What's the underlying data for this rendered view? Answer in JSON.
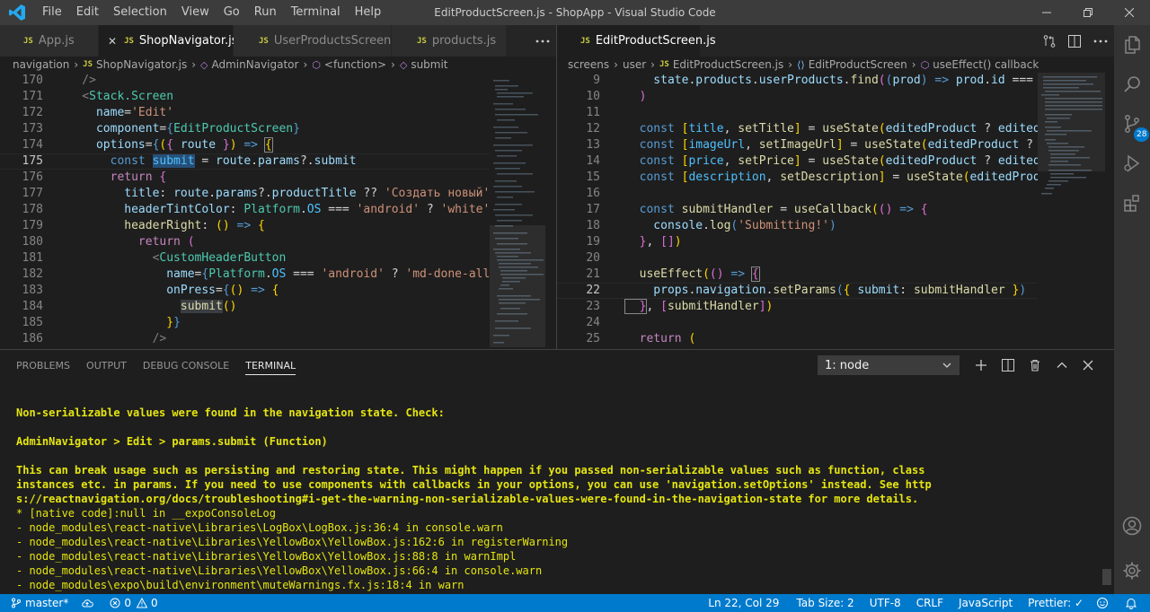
{
  "titlebar": {
    "menu": [
      "File",
      "Edit",
      "Selection",
      "View",
      "Go",
      "Run",
      "Terminal",
      "Help"
    ],
    "title": "EditProductScreen.js - ShopApp - Visual Studio Code"
  },
  "left_group": {
    "tabs": [
      {
        "label": "App.js",
        "active": false
      },
      {
        "label": "ShopNavigator.js",
        "active": true
      },
      {
        "label": "UserProductsScreen.js",
        "active": false
      },
      {
        "label": "products.js",
        "active": false
      }
    ],
    "tab_icon": "JS",
    "breadcrumb": [
      "navigation",
      "ShopNavigator.js",
      "AdminNavigator",
      "<function>",
      "submit"
    ],
    "line_numbers": [
      "170",
      "171",
      "172",
      "173",
      "174",
      "175",
      "176",
      "177",
      "178",
      "179",
      "180",
      "181",
      "182",
      "183",
      "184",
      "185",
      "186"
    ],
    "current_line": "175",
    "lines": [
      "    />",
      "    <Stack.Screen",
      "      name='Edit'",
      "      component={EditProductScreen}",
      "      options={({ route }) => {",
      "        const submit = route.params?.submit",
      "        return {",
      "          title: route.params?.productTitle ?? 'Создать новый',",
      "          headerTintColor: Platform.OS === 'android' ? 'white' : Colo",
      "          headerRight: () => {",
      "            return (",
      "              <CustomHeaderButton",
      "                name={Platform.OS === 'android' ? 'md-done-all' : 'io",
      "                onPress={() => {",
      "                  submit()",
      "                }}",
      "              />"
    ]
  },
  "right_group": {
    "tabs": [
      {
        "label": "EditProductScreen.js",
        "active": true
      }
    ],
    "tab_icon": "JS",
    "breadcrumb": [
      "screens",
      "user",
      "EditProductScreen.js",
      "EditProductScreen",
      "useEffect() callback"
    ],
    "line_numbers": [
      "9",
      "10",
      "11",
      "12",
      "13",
      "14",
      "15",
      "16",
      "17",
      "18",
      "19",
      "20",
      "21",
      "22",
      "23",
      "24",
      "25"
    ],
    "current_line": "22",
    "lines": [
      "    state.products.userProducts.find((prod) => prod.id === prodId)",
      "  )",
      "",
      "  const [title, setTitle] = useState(editedProduct ? editedProduct",
      "  const [imageUrl, setImageUrl] = useState(editedProduct ? editedP",
      "  const [price, setPrice] = useState(editedProduct ? editedProduct",
      "  const [description, setDescription] = useState(editedProduct ? e",
      "",
      "  const submitHandler = useCallback(() => {",
      "    console.log('Submitting!')",
      "  }, [])",
      "",
      "  useEffect(() => {",
      "    props.navigation.setParams({ submit: submitHandler })",
      "  }, [submitHandler])",
      "",
      "  return ("
    ]
  },
  "panel": {
    "tabs": [
      "PROBLEMS",
      "OUTPUT",
      "DEBUG CONSOLE",
      "TERMINAL"
    ],
    "active_tab": "TERMINAL",
    "terminal_select": "1: node",
    "terminal_lines": [
      {
        "text": "Non-serializable values were found in the navigation state. Check:",
        "kind": "warn"
      },
      {
        "text": "",
        "kind": "normal"
      },
      {
        "text": "AdminNavigator > Edit > params.submit (Function)",
        "kind": "warn"
      },
      {
        "text": "",
        "kind": "normal"
      },
      {
        "text": "This can break usage such as persisting and restoring state. This might happen if you passed non-serializable values such as function, class",
        "kind": "warn"
      },
      {
        "text": "instances etc. in params. If you need to use components with callbacks in your options, you can use 'navigation.setOptions' instead. See http",
        "kind": "warn"
      },
      {
        "text": "s://reactnavigation.org/docs/troubleshooting#i-get-the-warning-non-serializable-values-were-found-in-the-navigation-state for more details.",
        "kind": "warn"
      },
      {
        "text": "* [native code]:null in __expoConsoleLog",
        "kind": "warn-plain"
      },
      {
        "text": "- node_modules\\react-native\\Libraries\\LogBox\\LogBox.js:36:4 in console.warn",
        "kind": "warn-plain"
      },
      {
        "text": "- node_modules\\react-native\\Libraries\\YellowBox\\YellowBox.js:162:6 in registerWarning",
        "kind": "warn-plain"
      },
      {
        "text": "- node_modules\\react-native\\Libraries\\YellowBox\\YellowBox.js:88:8 in warnImpl",
        "kind": "warn-plain"
      },
      {
        "text": "- node_modules\\react-native\\Libraries\\YellowBox\\YellowBox.js:66:4 in console.warn",
        "kind": "warn-plain"
      },
      {
        "text": "- node_modules\\expo\\build\\environment\\muteWarnings.fx.js:18:4 in warn",
        "kind": "warn-plain"
      }
    ]
  },
  "statusbar": {
    "branch": "master*",
    "errors": "0",
    "warnings": "0",
    "position": "Ln 22, Col 29",
    "tab_size": "Tab Size: 2",
    "encoding": "UTF-8",
    "eol": "CRLF",
    "language": "JavaScript",
    "formatter": "Prettier: ✓"
  },
  "activitybar": {
    "scm_badge": "28",
    "icons": [
      "files-icon",
      "search-icon",
      "source-control-icon",
      "run-debug-icon",
      "extensions-icon",
      "account-icon",
      "settings-gear-icon"
    ]
  },
  "colors": {
    "accent": "#007acc",
    "editor_bg": "#1e1e1e",
    "titlebar_bg": "#3c3c3c",
    "warning_yellow": "#e5e510"
  }
}
